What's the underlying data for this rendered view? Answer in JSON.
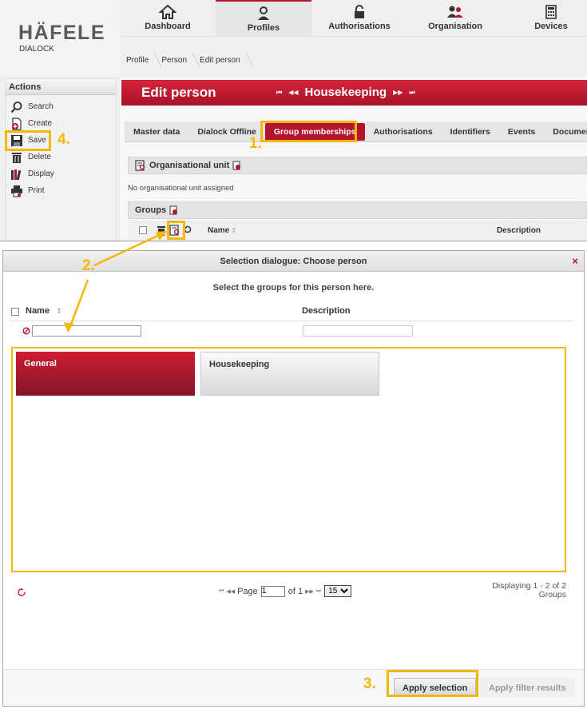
{
  "brand": {
    "logo": "HÄFELE",
    "product": "DIALOCK"
  },
  "topnav": [
    {
      "label": "Dashboard",
      "icon": "home-icon"
    },
    {
      "label": "Profiles",
      "icon": "person-icon"
    },
    {
      "label": "Authorisations",
      "icon": "lock-icon"
    },
    {
      "label": "Organisation",
      "icon": "people-icon"
    },
    {
      "label": "Devices",
      "icon": "calculator-icon"
    }
  ],
  "breadcrumb": [
    "Profile",
    "Person",
    "Edit person"
  ],
  "actions": {
    "title": "Actions",
    "items": [
      "Search",
      "Create",
      "Save",
      "Delete",
      "Display",
      "Print"
    ]
  },
  "edit": {
    "title": "Edit person",
    "record": "Housekeeping"
  },
  "tabs": [
    "Master data",
    "Dialock Offline",
    "Group memberships",
    "Authorisations",
    "Identifiers",
    "Events",
    "Documents"
  ],
  "org_unit": {
    "title": "Organisational unit",
    "empty": "No organisational unit assigned"
  },
  "groups": {
    "title": "Groups",
    "col_name": "Name",
    "col_desc": "Description"
  },
  "dialog": {
    "title": "Selection dialogue: Choose person",
    "close": "×",
    "info": "Select the groups for this person here.",
    "col_name": "Name",
    "col_desc": "Description",
    "filter_name": "",
    "filter_desc": "",
    "tiles": [
      "General",
      "Housekeeping"
    ],
    "pager": {
      "page_label": "Page",
      "page": "1",
      "of": "of 1",
      "page_size": "15",
      "status_line1": "Displaying 1 - 2 of 2",
      "status_line2": "Groups"
    },
    "apply_selection": "Apply selection",
    "apply_filter": "Apply filter results"
  },
  "steps": [
    "1.",
    "2.",
    "3.",
    "4."
  ],
  "colors": {
    "brand_red": "#b5142d",
    "highlight": "#f5b700"
  }
}
